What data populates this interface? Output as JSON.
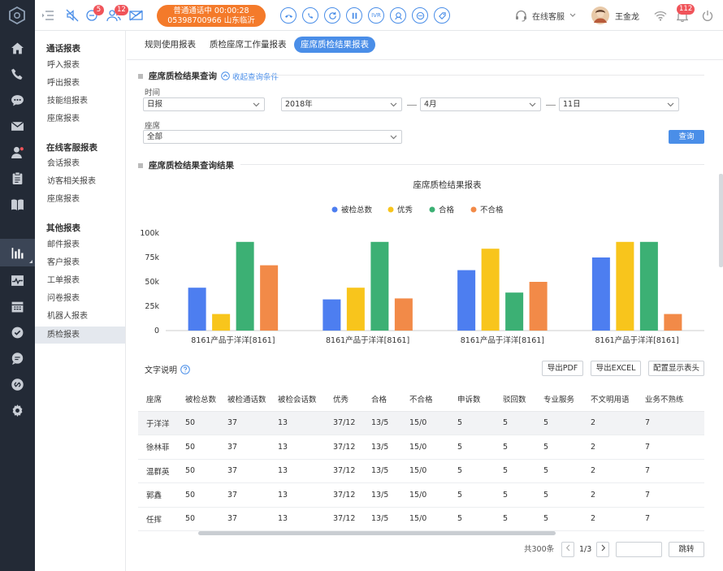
{
  "topbar": {
    "badges": {
      "chat": "5",
      "visitors": "12",
      "notifications": "112"
    },
    "call": {
      "line1": "普通通话中  00:00:28",
      "line2": "05398700966 山东临沂"
    },
    "ivr_label": "IVR",
    "status_label": "在线客服",
    "user_name": "王金龙"
  },
  "sidebar": {
    "groups": [
      {
        "title": "通话报表",
        "items": [
          "呼入报表",
          "呼出报表",
          "技能组报表",
          "座席报表"
        ]
      },
      {
        "title": "在线客服报表",
        "items": [
          "会话报表",
          "访客相关报表",
          "座席报表"
        ]
      },
      {
        "title": "其他报表",
        "items": [
          "邮件报表",
          "客户报表",
          "工单报表",
          "问卷报表",
          "机器人报表",
          "质检报表"
        ]
      }
    ],
    "active_item": "质检报表"
  },
  "tabs": [
    "规则使用报表",
    "质检座席工作量报表",
    "座席质检结果报表"
  ],
  "active_tab": "座席质检结果报表",
  "query": {
    "title": "座席质检结果查询",
    "collapse_label": "收起查询条件",
    "time_label": "时间",
    "period": "日报",
    "year": "2018年",
    "month": "4月",
    "day": "11日",
    "agent_label": "座席",
    "agent": "全部",
    "query_button": "查询"
  },
  "results": {
    "title": "座席质检结果查询结果"
  },
  "chart_data": {
    "type": "bar",
    "title": "座席质检结果报表",
    "categories": [
      "8161产品于洋洋[8161]",
      "8161产品于洋洋[8161]",
      "8161产品于洋洋[8161]",
      "8161产品于洋洋[8161]"
    ],
    "series": [
      {
        "name": "被检总数",
        "color": "#4d7ef0",
        "values": [
          44000,
          32000,
          62000,
          75000
        ]
      },
      {
        "name": "优秀",
        "color": "#f8c51c",
        "values": [
          17000,
          44000,
          84000,
          91000
        ]
      },
      {
        "name": "合格",
        "color": "#3cb074",
        "values": [
          91000,
          91000,
          39000,
          91000
        ]
      },
      {
        "name": "不合格",
        "color": "#f28a48",
        "values": [
          67000,
          33000,
          50000,
          17000
        ]
      }
    ],
    "yticks": [
      "0",
      "25k",
      "50k",
      "75k",
      "100k"
    ],
    "ylim": [
      0,
      100000
    ],
    "legend_position": "top-center",
    "grid": false
  },
  "notes": {
    "label": "文字说明",
    "export_pdf": "导出PDF",
    "export_excel": "导出EXCEL",
    "config_header": "配置显示表头"
  },
  "table": {
    "columns": [
      "座席",
      "被检总数",
      "被检通话数",
      "被检会话数",
      "优秀",
      "合格",
      "不合格",
      "申诉数",
      "驳回数",
      "专业服务",
      "不文明用语",
      "业务不熟练"
    ],
    "rows": [
      [
        "于洋洋",
        "50",
        "37",
        "13",
        "37/12",
        "13/5",
        "15/0",
        "5",
        "5",
        "5",
        "2",
        "7"
      ],
      [
        "徐林菲",
        "50",
        "37",
        "13",
        "37/12",
        "13/5",
        "15/0",
        "5",
        "5",
        "5",
        "2",
        "7"
      ],
      [
        "温群英",
        "50",
        "37",
        "13",
        "37/12",
        "13/5",
        "15/0",
        "5",
        "5",
        "5",
        "2",
        "7"
      ],
      [
        "郭鑫",
        "50",
        "37",
        "13",
        "37/12",
        "13/5",
        "15/0",
        "5",
        "5",
        "5",
        "2",
        "7"
      ],
      [
        "任挥",
        "50",
        "37",
        "13",
        "37/12",
        "13/5",
        "15/0",
        "5",
        "5",
        "5",
        "2",
        "7"
      ]
    ]
  },
  "pagination": {
    "total": "共300条",
    "page": "1/3",
    "jump": "跳转"
  }
}
